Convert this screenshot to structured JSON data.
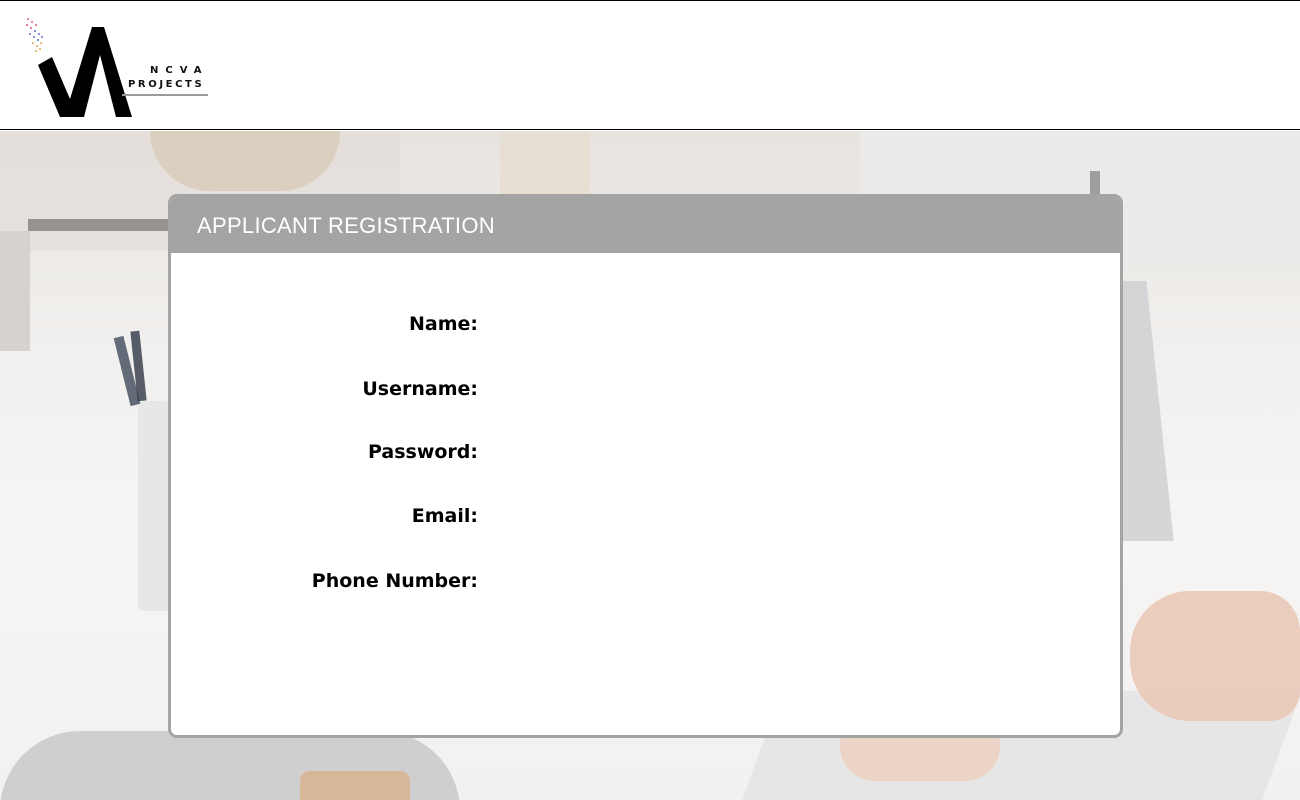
{
  "brand": {
    "logo_icon": "va-logo-icon",
    "logo_line1": "NCVA",
    "logo_line2": "PROJECTS"
  },
  "panel": {
    "title": "APPLICANT REGISTRATION",
    "header_color": "#a4a4a4"
  },
  "form": {
    "fields": [
      {
        "label": "Name:",
        "value": "",
        "placeholder": ""
      },
      {
        "label": "Username:",
        "value": "",
        "placeholder": ""
      },
      {
        "label": "Password:",
        "value": "",
        "placeholder": ""
      },
      {
        "label": "Email:",
        "value": "",
        "placeholder": ""
      },
      {
        "label": "Phone Number:",
        "value": "",
        "placeholder": ""
      }
    ]
  }
}
